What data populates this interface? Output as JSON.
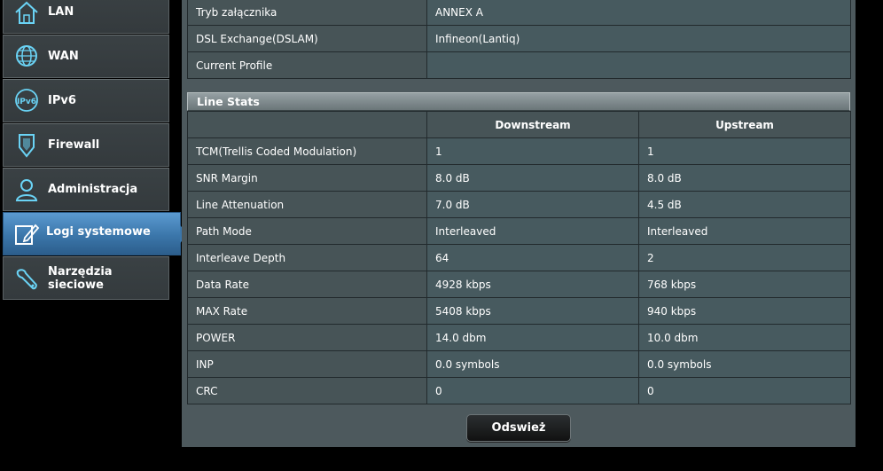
{
  "sidebar": {
    "items": [
      {
        "label": "LAN",
        "icon": "home-icon"
      },
      {
        "label": "WAN",
        "icon": "globe-icon"
      },
      {
        "label": "IPv6",
        "icon": "ipv6-icon"
      },
      {
        "label": "Firewall",
        "icon": "shield-icon"
      },
      {
        "label": "Administracja",
        "icon": "user-icon"
      },
      {
        "label": "Logi systemowe",
        "icon": "edit-icon"
      },
      {
        "label": "Narzędzia\nsieciowe",
        "icon": "wrench-icon"
      }
    ],
    "active": "Logi systemowe",
    "accent_color": "#3b76aa",
    "icon_color": "#6ad3f5"
  },
  "info_rows": [
    {
      "label": "Tryb załącznika",
      "value": "ANNEX A"
    },
    {
      "label": "DSL Exchange(DSLAM)",
      "value": "Infineon(Lantiq)"
    },
    {
      "label": "Current Profile",
      "value": ""
    }
  ],
  "line_stats": {
    "title": "Line Stats",
    "columns": [
      "Downstream",
      "Upstream"
    ],
    "rows": [
      {
        "label": "TCM(Trellis Coded Modulation)",
        "down": "1",
        "up": "1"
      },
      {
        "label": "SNR Margin",
        "down": "8.0 dB",
        "up": "8.0 dB"
      },
      {
        "label": "Line Attenuation",
        "down": "7.0 dB",
        "up": "4.5 dB"
      },
      {
        "label": "Path Mode",
        "down": "Interleaved",
        "up": "Interleaved"
      },
      {
        "label": "Interleave Depth",
        "down": "64",
        "up": "2"
      },
      {
        "label": "Data Rate",
        "down": "4928 kbps",
        "up": "768 kbps"
      },
      {
        "label": "MAX Rate",
        "down": "5408 kbps",
        "up": "940 kbps"
      },
      {
        "label": "POWER",
        "down": "14.0 dbm",
        "up": "10.0 dbm"
      },
      {
        "label": "INP",
        "down": "0.0 symbols",
        "up": "0.0 symbols"
      },
      {
        "label": "CRC",
        "down": "0",
        "up": "0"
      }
    ]
  },
  "refresh_label": "Odswież"
}
